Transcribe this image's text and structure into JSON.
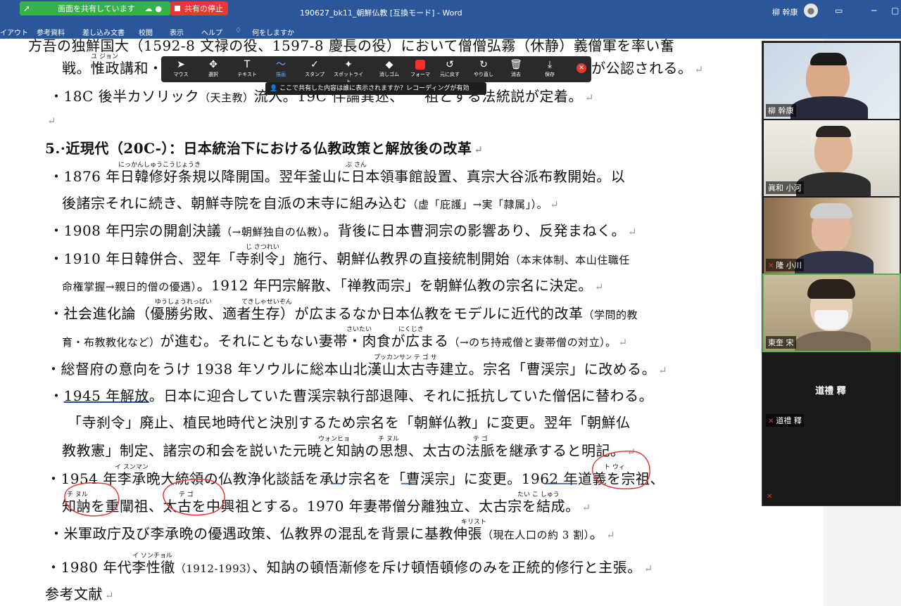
{
  "titlebar": {
    "share_status": "画面を共有しています",
    "stop_share": "共有の停止",
    "doc_title": "190627_bk11_朝鮮仏教 [互換モード] - Word",
    "user": "柳 幹康"
  },
  "ribbon_tabs": [
    "イアウト",
    "参考資料",
    "差し込み文書",
    "校閲",
    "表示",
    "ヘルプ",
    "何をしますか"
  ],
  "annotation_toolbar": {
    "tools": [
      "マウス",
      "選択",
      "テキスト",
      "描画",
      "スタンプ",
      "スポットライト",
      "消しゴム",
      "フォーマ",
      "元に戻す",
      "やり直し",
      "消去",
      "保存"
    ],
    "tip": "ここで共有した内容は誰に表示されますか？レコーディングが有効"
  },
  "doc": {
    "line0": "戦。惟政講和・",
    "line0_end": "が公認される。",
    "line1a": "・18C 後半カソリック（天主教）流入。19C 伴論",
    "line1b": "以来，祖とする法統説が定着。",
    "heading": "5.·近現代（20C-）：日本統治下における仏教政策と解放後の改革",
    "l2": "・1876 年日韓修好条規以降開国。翌年釜山に日本領事館設置、真宗大谷派布教開始。以",
    "l3a": "後諸宗それに続き、朝鮮寺院を自派の末寺に組み込む",
    "l3b": "（虚「庇護」→実「隷属」）。",
    "l4a": "・1908 年円宗の開創決議",
    "l4b": "（→朝鮮独自の仏教）",
    "l4c": "。背後に日本曹洞宗の影響あり、反発まねく。",
    "l5a": "・1910 年日韓併合、翌年「寺刹令」施行、朝鮮仏教界の直接統制開始",
    "l5b": "（本末体制、本山住職任",
    "l6a": "命権掌握→親日的僧の優遇）",
    "l6b": "。1912 年円宗解散、「禅教両宗」を朝鮮仏教の宗名に決定。",
    "l7a": "・社会進化論（優勝劣敗、適者生存）が広まるなか日本仏教をモデルに近代的改革",
    "l7b": "（学問的教",
    "l8a": "育・布教教化など）",
    "l8b": "が進む。それにともない妻帯・肉食が広まる",
    "l8c": "（→のち持戒僧と妻帯僧の対立）。",
    "l9": "・総督府の意向をうけ 1938 年ソウルに総本山北漢山太古寺建立。宗名「曹渓宗」に改める。",
    "l10a": "・",
    "l10u": "1945 年解放",
    "l10b": "。日本に迎合していた曹渓宗執行部退陣、それに抵抗していた僧侶に替わる。",
    "l11": "「寺刹令」廃止、植民地時代と決別するため宗名を「朝鮮仏教」に変更。翌年「朝鮮仏",
    "l12": "教教憲」制定、諸宗の和会を説いた元暁と知訥の思想、太古の法脈を継承すると明記。",
    "l13": "・1954 年李承晩大統領の仏教浄化談話を承け宗名を「曹渓宗」に変更。1962 年道義を宗祖、",
    "l14": "知訥を重闡祖、太古を中興祖とする。1970 年妻帯僧分離独立、太古宗を結成。",
    "l15a": "・米軍政庁及び李承晩の優遇政策、仏教界の混乱を背景に基教伸張",
    "l15b": "（現在人口の約 3 割）",
    "l15c": "。",
    "l16a": "・1980 年代李性徹",
    "l16b": "（1912-1993）",
    "l16c": "、知訥の頓悟漸修を斥け頓悟頓修のみを正統的修行と主張。",
    "l17": "参考文献",
    "rubies": {
      "r0": "ユ ジョン",
      "r1": "にっかんしゅうこうじょうき",
      "r2": "ぷ さん",
      "r3": "じ さつれい",
      "r4": "ゆうしょうれっぱい",
      "r5": "てきしゃせいぞん",
      "r6": "さいたい",
      "r7": "にくじき",
      "r8": "プッカンサン テ ゴ サ",
      "r9": "ウォンヒョ",
      "r10": "チ ヌル",
      "r11": "テ ゴ",
      "r12": "イ スンマン",
      "r13": "ト ウィ",
      "r14": "チ ヌル",
      "r15": "テ ゴ",
      "r16": "たい こ しゅう",
      "r17": "キリスト",
      "r18": "イ ソンチョル"
    }
  },
  "participants": [
    {
      "name": "柳 幹康"
    },
    {
      "name": "眞和 小河"
    },
    {
      "name": "隆 小川"
    },
    {
      "name": "東奎 宋"
    },
    {
      "name": "道禮 釋",
      "audio_only": true
    }
  ],
  "colors": {
    "word_blue": "#2b579a",
    "share_green": "#35b24a",
    "stop_red": "#e53935",
    "ink_red": "#e23a3a"
  }
}
